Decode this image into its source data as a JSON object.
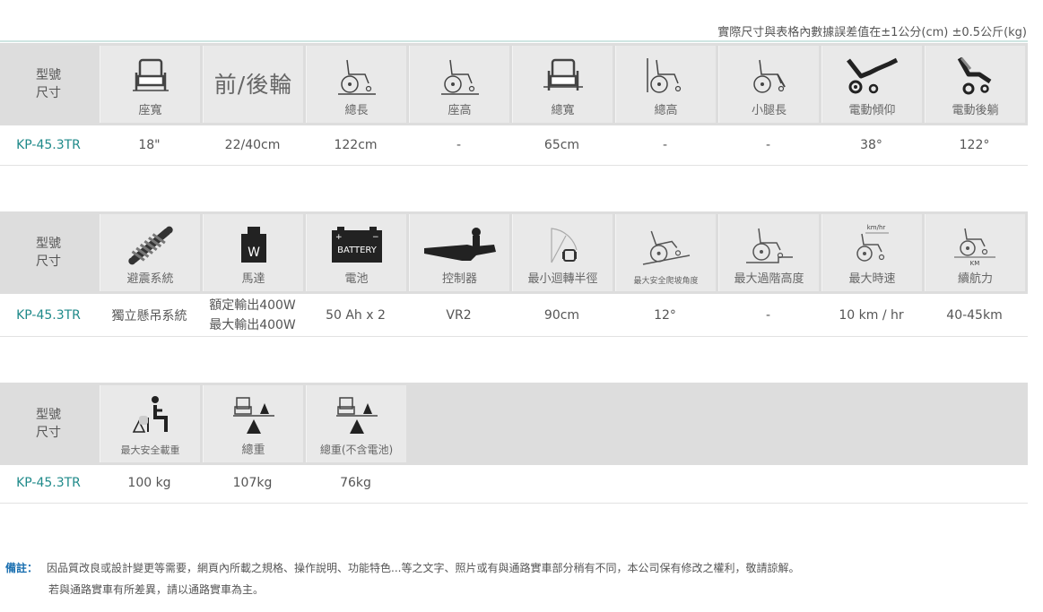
{
  "top_note": "實際尺寸與表格內數據誤差值在±1公分(cm) ±0.5公斤(kg)",
  "header_first": {
    "line1": "型號",
    "line2": "尺寸"
  },
  "table1": {
    "headers": [
      {
        "label": "座寬",
        "icon": "seat-width-icon"
      },
      {
        "label": "前/後輪",
        "icon": "none"
      },
      {
        "label": "總長",
        "icon": "wheelchair-length-icon"
      },
      {
        "label": "座高",
        "icon": "wheelchair-seat-height-icon"
      },
      {
        "label": "總寬",
        "icon": "total-width-icon"
      },
      {
        "label": "總高",
        "icon": "wheelchair-height-icon"
      },
      {
        "label": "小腿長",
        "icon": "wheelchair-leg-length-icon"
      },
      {
        "label": "電動傾仰",
        "icon": "tilt-icon"
      },
      {
        "label": "電動後躺",
        "icon": "recline-icon"
      }
    ],
    "row": {
      "model": "KP-45.3TR",
      "values": [
        "18\"",
        "22/40cm",
        "122cm",
        "-",
        "65cm",
        "-",
        "-",
        "38°",
        "122°"
      ]
    }
  },
  "table2": {
    "headers": [
      {
        "label": "避震系統",
        "icon": "spring-icon"
      },
      {
        "label": "馬達",
        "icon": "motor-icon",
        "icon_text": "W"
      },
      {
        "label": "電池",
        "icon": "battery-icon",
        "icon_text": "BATTERY"
      },
      {
        "label": "控制器",
        "icon": "controller-icon"
      },
      {
        "label": "最小迴轉半徑",
        "icon": "turning-radius-icon"
      },
      {
        "label": "最大安全爬坡角度",
        "icon": "slope-icon"
      },
      {
        "label": "最大過階高度",
        "icon": "step-height-icon"
      },
      {
        "label": "最大時速",
        "icon": "speed-icon",
        "icon_text": "km/hr"
      },
      {
        "label": "續航力",
        "icon": "range-icon",
        "icon_text": "KM"
      }
    ],
    "row": {
      "model": "KP-45.3TR",
      "values": [
        "獨立懸吊系統",
        "額定輸出400W",
        "50 Ah x 2",
        "VR2",
        "90cm",
        "12°",
        "-",
        "10 km / hr",
        "40-45km"
      ],
      "motor_line2": "最大輸出400W"
    }
  },
  "table3": {
    "headers": [
      {
        "label": "最大安全載重",
        "icon": "max-load-icon"
      },
      {
        "label": "總重",
        "icon": "total-weight-icon"
      },
      {
        "label": "總重(不含電池)",
        "icon": "weight-no-battery-icon"
      }
    ],
    "row": {
      "model": "KP-45.3TR",
      "values": [
        "100 kg",
        "107kg",
        "76kg"
      ]
    }
  },
  "footer": {
    "lead": "備註：",
    "line1": "因品質改良或設計變更等需要，網頁內所載之規格、操作說明、功能特色...等之文字、照片或有與通路實車部分稍有不同，本公司保有修改之權利，敬請諒解。",
    "line2": "若與通路實車有所差異，請以通路實車為主。"
  }
}
